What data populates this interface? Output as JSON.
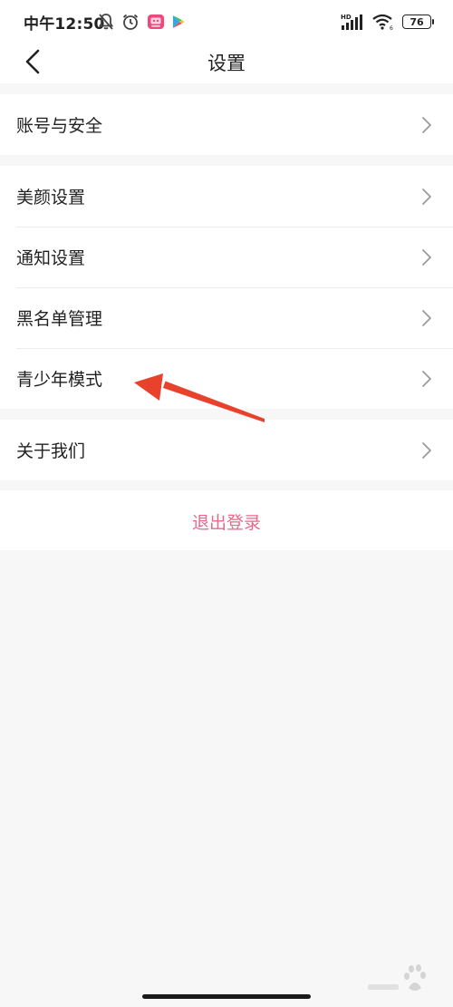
{
  "status_bar": {
    "time": "中午12:50",
    "left_icons": [
      "bell-off-icon",
      "alarm-icon",
      "app-notification-icon",
      "play-store-icon"
    ],
    "right_icons": [
      "hd-signal-icon",
      "wifi-icon"
    ],
    "battery_level": "76"
  },
  "header": {
    "title": "设置",
    "back_icon": "chevron-left-icon"
  },
  "settings": {
    "groups": [
      {
        "items": [
          {
            "label": "账号与安全"
          }
        ]
      },
      {
        "items": [
          {
            "label": "美颜设置"
          },
          {
            "label": "通知设置"
          },
          {
            "label": "黑名单管理"
          },
          {
            "label": "青少年模式"
          }
        ]
      },
      {
        "items": [
          {
            "label": "关于我们"
          }
        ]
      }
    ],
    "logout_label": "退出登录"
  },
  "colors": {
    "background": "#f7f7f7",
    "card": "#ffffff",
    "logout_text": "#e8698c",
    "annotation_arrow": "#e8412c"
  }
}
